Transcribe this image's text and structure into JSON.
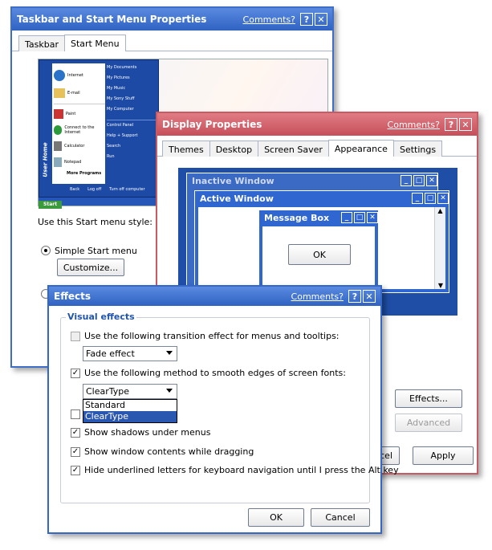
{
  "taskbar_window": {
    "title": "Taskbar and Start Menu Properties",
    "comments": "Comments?",
    "help": "?",
    "close": "✕",
    "tabs": [
      "Taskbar",
      "Start Menu"
    ],
    "style_label": "Use this Start menu style:",
    "simple_option": "Simple Start menu",
    "customize": "Customize...",
    "preview": {
      "user": "User Home",
      "left_items": [
        "Internet",
        "E-mail",
        "Paint",
        "Connect to the Internet",
        "Calculator",
        "Notepad"
      ],
      "right_items": [
        "My Documents",
        "My Pictures",
        "My Music",
        "My Sony Stuff",
        "My Computer",
        "Control Panel",
        "Help + Support",
        "Search",
        "Run"
      ],
      "more_programs": "More Programs",
      "start": "Start",
      "log_off": "Log off",
      "turn_off": "Turn off computer",
      "back": "Back"
    }
  },
  "display_window": {
    "title": "Display Properties",
    "comments": "Comments?",
    "help": "?",
    "close": "✕",
    "tabs": [
      "Themes",
      "Desktop",
      "Screen Saver",
      "Appearance",
      "Settings"
    ],
    "inactive_window": "Inactive Window",
    "active_window": "Active Window",
    "message_box": "Message Box",
    "ok": "OK",
    "effects": "Effects...",
    "advanced": "Advanced",
    "cancel_partial": "cel",
    "apply": "Apply"
  },
  "effects_window": {
    "title": "Effects",
    "comments": "Comments?",
    "help": "?",
    "close": "✕",
    "group_label": "Visual effects",
    "transition_label": "Use the following transition effect for menus and tooltips:",
    "transition_value": "Fade effect",
    "smooth_label": "Use the following method to smooth edges of screen fonts:",
    "smooth_value": "ClearType",
    "smooth_options": [
      "Standard",
      "ClearType"
    ],
    "shadows_label": "Show shadows under menus",
    "drag_label": "Show window contents while dragging",
    "underline_label": "Hide underlined letters for keyboard navigation until I press the Alt key",
    "ok": "OK",
    "cancel": "Cancel"
  },
  "colors": {
    "taskbar_border": "#3f6ec8",
    "display_border": "#c75a63",
    "effects_border": "#3467c6",
    "titlebar_blue": "#3a6fd0",
    "titlebar_red": "#d4626c",
    "preview_blue": "#1d4aa5"
  }
}
